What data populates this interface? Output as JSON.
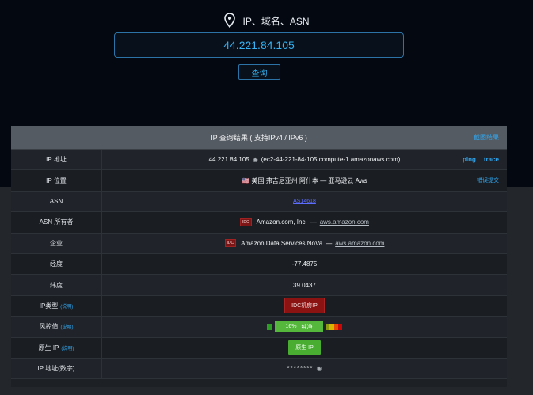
{
  "header": {
    "title": "IP、域名、ASN",
    "search_value": "44.221.84.105",
    "query_label": "查询"
  },
  "panel": {
    "title": "IP 查询结果 ( 支持IPv4 / IPv6 )",
    "screenshot_link": "截图结果",
    "rows": {
      "ip": {
        "label": "IP 地址",
        "value": "44.221.84.105",
        "hostname": "(ec2-44-221-84-105.compute-1.amazonaws.com)",
        "ping": "ping",
        "trace": "trace"
      },
      "location": {
        "label": "IP 位置",
        "value": "🇺🇸 美国 弗吉尼亚州 阿什本 — 亚马逊云 Aws",
        "report": "错误提交"
      },
      "asn": {
        "label": "ASN",
        "value": "AS14618"
      },
      "asn_owner": {
        "label": "ASN 所有者",
        "idc": "IDC",
        "company": "Amazon.com, Inc.",
        "separator": " — ",
        "domain": "aws.amazon.com"
      },
      "company": {
        "label": "企业",
        "idc": "IDC",
        "company": "Amazon Data Services NoVa",
        "separator": " — ",
        "domain": "aws.amazon.com"
      },
      "longitude": {
        "label": "经度",
        "value": "-77.4875"
      },
      "latitude": {
        "label": "纬度",
        "value": "39.0437"
      },
      "ip_type": {
        "label": "IP类型",
        "link": "(说明)",
        "value": "IDC机房IP"
      },
      "risk": {
        "label": "风控值",
        "link": "(说明)",
        "percent": "16%",
        "text": "纯净",
        "level": 0.16
      },
      "native_ip": {
        "label": "原生 IP",
        "link": "(说明)",
        "value": "原生 IP"
      },
      "numeric_ip": {
        "label": "IP 地址(数字)",
        "value": "********"
      }
    }
  }
}
